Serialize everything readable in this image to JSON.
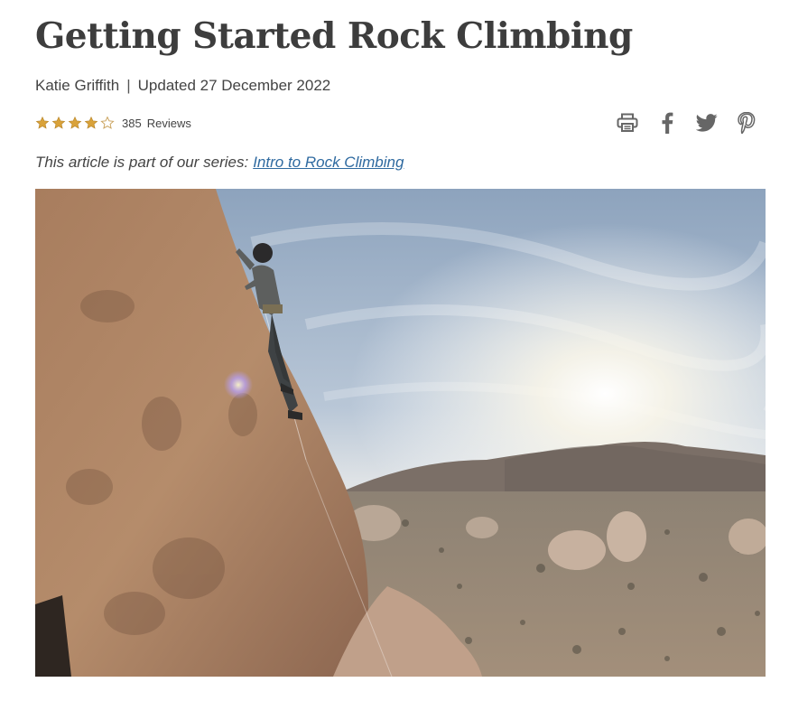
{
  "article": {
    "title": "Getting Started Rock Climbing",
    "author": "Katie Griffith",
    "separator": "|",
    "updated": "Updated 27 December 2022",
    "rating": {
      "value": 4,
      "max": 5,
      "count": "385",
      "label": "Reviews"
    },
    "series_prefix": "This article is part of our series:",
    "series_link": "Intro to Rock Climbing"
  },
  "share": {
    "icons": [
      "print-icon",
      "facebook-icon",
      "twitter-icon",
      "pinterest-icon"
    ]
  },
  "hero_image": {
    "subject": "climber on rock face above desert valley",
    "icon": "photo"
  },
  "colors": {
    "star": "#d9a23a",
    "link": "#2f6aa0",
    "icon": "#666666"
  }
}
